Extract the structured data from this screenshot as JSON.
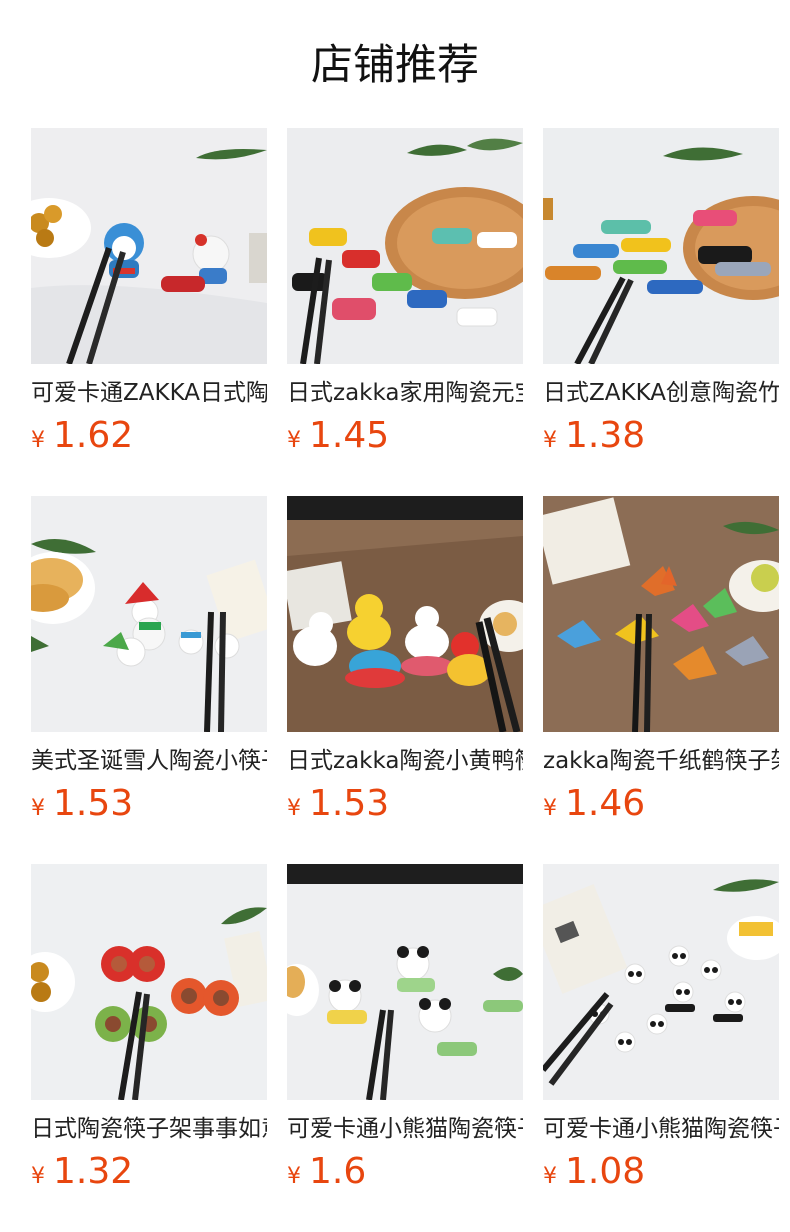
{
  "header": {
    "title": "店铺推荐"
  },
  "currency": "¥",
  "products": [
    {
      "name": "可爱卡通ZAKKA日式陶瓷筷子架",
      "price": "1.62"
    },
    {
      "name": "日式zakka家用陶瓷元宝筷子架",
      "price": "1.45"
    },
    {
      "name": "日式ZAKKA创意陶瓷竹节筷子架",
      "price": "1.38"
    },
    {
      "name": "美式圣诞雪人陶瓷小筷子架",
      "price": "1.53"
    },
    {
      "name": "日式zakka陶瓷小黄鸭筷子架",
      "price": "1.53"
    },
    {
      "name": "zakka陶瓷千纸鹤筷子架",
      "price": "1.46"
    },
    {
      "name": "日式陶瓷筷子架事事如意",
      "price": "1.32"
    },
    {
      "name": "可爱卡通小熊猫陶瓷筷子架",
      "price": "1.6"
    },
    {
      "name": "可爱卡通小熊猫陶瓷筷子架",
      "price": "1.08"
    }
  ]
}
